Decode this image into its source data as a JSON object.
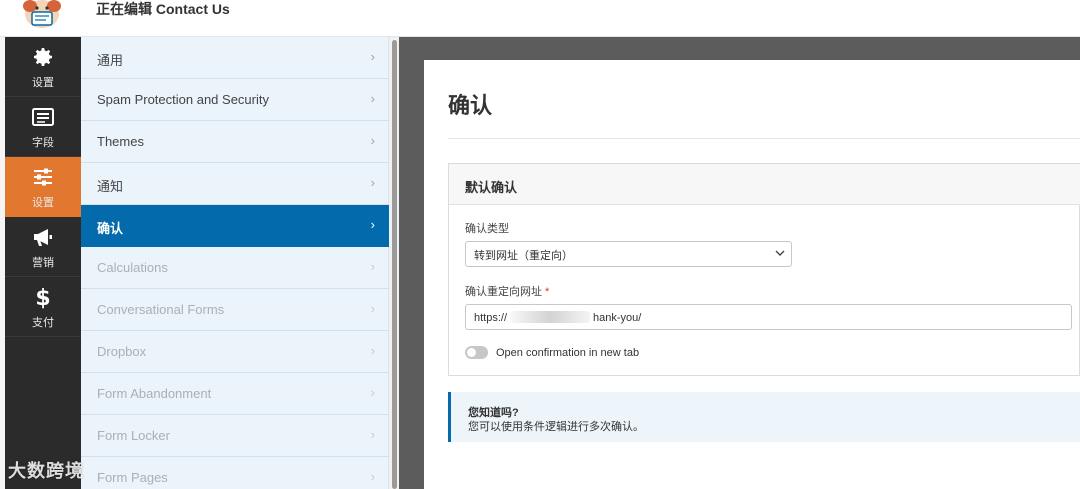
{
  "header": {
    "title": "正在编辑 Contact Us"
  },
  "icon_nav": [
    {
      "label": "设置",
      "icon": "gear-icon",
      "active": false
    },
    {
      "label": "字段",
      "icon": "fields-list-icon",
      "active": false
    },
    {
      "label": "设置",
      "icon": "sliders-icon",
      "active": true
    },
    {
      "label": "营销",
      "icon": "megaphone-icon",
      "active": false
    },
    {
      "label": "支付",
      "icon": "dollar-icon",
      "active": false
    }
  ],
  "settings_menu": [
    {
      "label": "通用",
      "state": "normal"
    },
    {
      "label": "Spam Protection and Security",
      "state": "normal"
    },
    {
      "label": "Themes",
      "state": "normal"
    },
    {
      "label": "通知",
      "state": "normal"
    },
    {
      "label": "确认",
      "state": "active"
    },
    {
      "label": "Calculations",
      "state": "disabled"
    },
    {
      "label": "Conversational Forms",
      "state": "disabled"
    },
    {
      "label": "Dropbox",
      "state": "disabled"
    },
    {
      "label": "Form Abandonment",
      "state": "disabled"
    },
    {
      "label": "Form Locker",
      "state": "disabled"
    },
    {
      "label": "Form Pages",
      "state": "disabled"
    }
  ],
  "chevron": "›",
  "content": {
    "title": "确认",
    "confirmation": {
      "header": "默认确认",
      "type_label": "确认类型",
      "type_value": "转到网址（重定向）",
      "url_label": "确认重定向网址",
      "required_mark": "*",
      "url_prefix": "https://",
      "url_suffix": "hank-you/",
      "toggle_label": "Open confirmation in new tab",
      "toggle_on": false
    },
    "notice": {
      "title": "您知道吗?",
      "text": "您可以使用条件逻辑进行多次确认。"
    }
  },
  "watermark": "大数跨境",
  "colors": {
    "accent_orange": "#e27730",
    "active_blue": "#036aab",
    "nav_dark": "#2b2b2b"
  }
}
